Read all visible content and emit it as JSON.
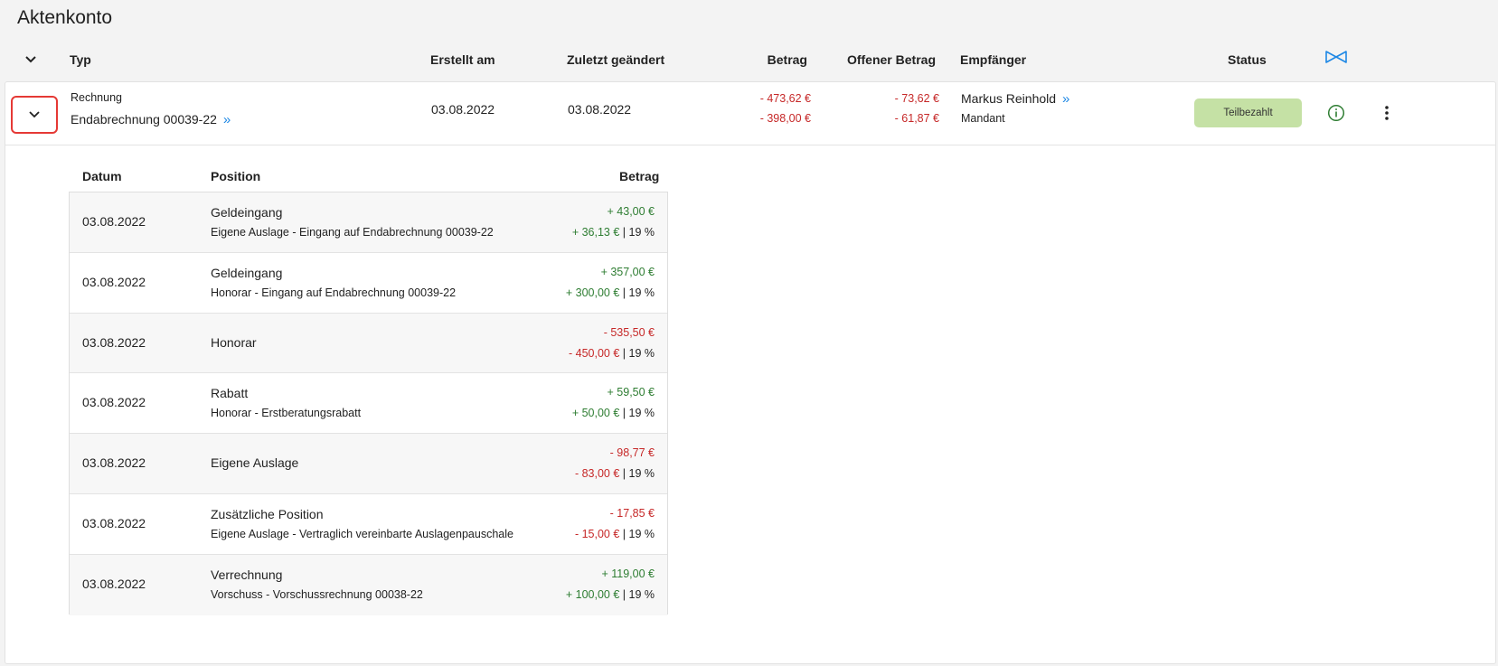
{
  "page": {
    "title": "Aktenkonto"
  },
  "colors": {
    "negative": "#c62828",
    "positive": "#2e7d32",
    "status_badge": "#c5e1a5",
    "link": "#1e88e5",
    "highlight": "#e53935"
  },
  "header": {
    "typ": "Typ",
    "erstellt": "Erstellt am",
    "geaendert": "Zuletzt geändert",
    "betrag": "Betrag",
    "offen": "Offener Betrag",
    "empfaenger": "Empfänger",
    "status": "Status",
    "collapse_icon": "chevron-down-icon",
    "columns_icon": "bowtie-columns-icon"
  },
  "entry": {
    "type_label": "Rechnung",
    "name": "Endabrechnung 00039-22",
    "link_mark": "»",
    "created": "03.08.2022",
    "changed": "03.08.2022",
    "betrag_gross": "- 473,62 €",
    "betrag_net": "- 398,00 €",
    "offen_gross": "- 73,62 €",
    "offen_net": "- 61,87 €",
    "recipient": "Markus Reinhold",
    "recipient_role": "Mandant",
    "status": "Teilbezahlt"
  },
  "positions": {
    "headers": {
      "datum": "Datum",
      "position": "Position",
      "betrag": "Betrag"
    },
    "rows": [
      {
        "datum": "03.08.2022",
        "title": "Geldeingang",
        "subtitle": "Eigene Auslage - Eingang auf Endabrechnung 00039-22",
        "gross": "+ 43,00 €",
        "net": "+ 36,13 €",
        "tax": "19 %",
        "sign": "positive"
      },
      {
        "datum": "03.08.2022",
        "title": "Geldeingang",
        "subtitle": "Honorar - Eingang auf Endabrechnung 00039-22",
        "gross": "+ 357,00 €",
        "net": "+ 300,00 €",
        "tax": "19 %",
        "sign": "positive"
      },
      {
        "datum": "03.08.2022",
        "title": "Honorar",
        "subtitle": "",
        "gross": "- 535,50 €",
        "net": "- 450,00 €",
        "tax": "19 %",
        "sign": "negative"
      },
      {
        "datum": "03.08.2022",
        "title": "Rabatt",
        "subtitle": "Honorar - Erstberatungsrabatt",
        "gross": "+ 59,50 €",
        "net": "+ 50,00 €",
        "tax": "19 %",
        "sign": "positive"
      },
      {
        "datum": "03.08.2022",
        "title": "Eigene Auslage",
        "subtitle": "",
        "gross": "- 98,77 €",
        "net": "- 83,00 €",
        "tax": "19 %",
        "sign": "negative"
      },
      {
        "datum": "03.08.2022",
        "title": "Zusätzliche Position",
        "subtitle": "Eigene Auslage - Vertraglich vereinbarte Auslagenpauschale",
        "gross": "- 17,85 €",
        "net": "- 15,00 €",
        "tax": "19 %",
        "sign": "negative"
      },
      {
        "datum": "03.08.2022",
        "title": "Verrechnung",
        "subtitle": "Vorschuss - Vorschussrechnung 00038-22",
        "gross": "+ 119,00 €",
        "net": "+ 100,00 €",
        "tax": "19 %",
        "sign": "positive"
      }
    ]
  }
}
